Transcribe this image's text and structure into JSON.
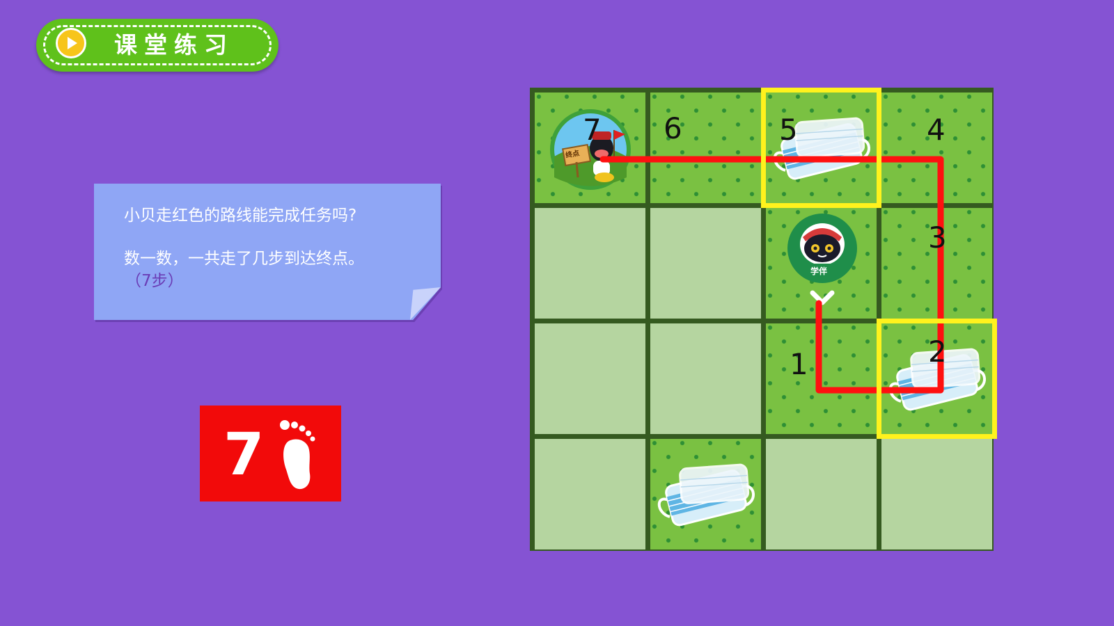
{
  "header": {
    "title": "课堂练习",
    "play_icon": "play-icon"
  },
  "question": {
    "line1": "小贝走红色的路线能完成任务吗?",
    "line2": "数一数，一共走了几步到达终点。",
    "answer": "（7步）"
  },
  "steps_badge": {
    "value": "7",
    "icon": "footprint-icon"
  },
  "board": {
    "rows": 4,
    "cols": 4,
    "grass_cells": [
      "0-0",
      "0-1",
      "0-2",
      "0-3",
      "1-2",
      "1-3",
      "2-2",
      "2-3",
      "3-1"
    ],
    "step_labels": [
      {
        "cell": "2-2",
        "label": "1"
      },
      {
        "cell": "2-3",
        "label": "2"
      },
      {
        "cell": "1-3",
        "label": "3"
      },
      {
        "cell": "0-3",
        "label": "4"
      },
      {
        "cell": "0-2",
        "label": "5"
      },
      {
        "cell": "0-1",
        "label": "6"
      },
      {
        "cell": "0-0",
        "label": "7"
      }
    ],
    "mask_cells": [
      "0-2",
      "2-3",
      "3-1"
    ],
    "highlighted_cells": [
      "0-2",
      "2-3"
    ],
    "start_cell": "1-2",
    "finish_cell": "0-0",
    "finish_sign": "终点",
    "robot_badge": "学伴",
    "route_color": "#ff1010",
    "highlight_color": "#fff21d",
    "grass_color": "#7ac142",
    "empty_color": "#b5d5a0"
  }
}
